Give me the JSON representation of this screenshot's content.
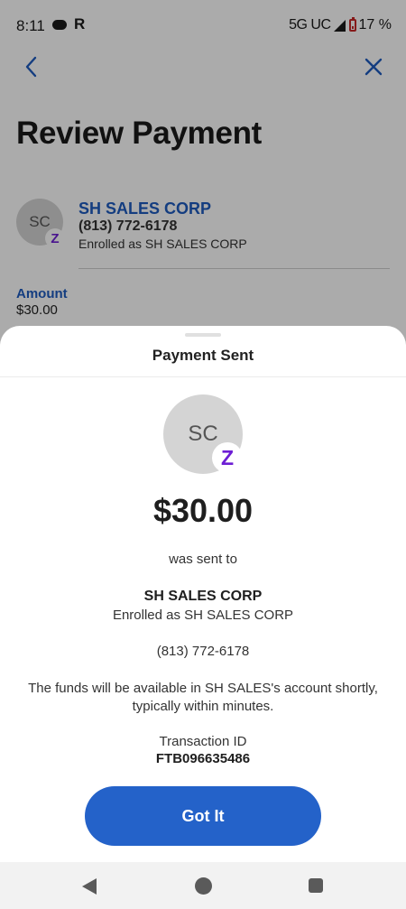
{
  "status_bar": {
    "time": "8:11",
    "r_label": "R",
    "network": "5G UC",
    "battery": "17 %"
  },
  "review": {
    "title": "Review Payment",
    "recipient": {
      "initials": "SC",
      "name": "SH SALES CORP",
      "phone": "(813) 772-6178",
      "enrolled": "Enrolled as SH SALES CORP"
    },
    "amount_label": "Amount",
    "amount_value": "$30.00"
  },
  "sheet": {
    "title": "Payment Sent",
    "avatar_initials": "SC",
    "zelle_glyph": "Z",
    "amount": "$30.00",
    "sent_to": "was sent to",
    "recipient_name": "SH SALES CORP",
    "recipient_enrolled": "Enrolled as SH SALES CORP",
    "recipient_phone": "(813) 772-6178",
    "funds_note": "The funds will be available in SH SALES's account shortly, typically within minutes.",
    "transaction_label": "Transaction ID",
    "transaction_id": "FTB096635486",
    "button_label": "Got It"
  },
  "colors": {
    "brand_blue": "#2462c9",
    "zelle_purple": "#6d1ed4"
  },
  "icons": [
    "back-arrow-icon",
    "close-icon",
    "zelle-icon",
    "signal-icon",
    "battery-icon",
    "nav-back-icon",
    "nav-home-icon",
    "nav-recents-icon"
  ]
}
